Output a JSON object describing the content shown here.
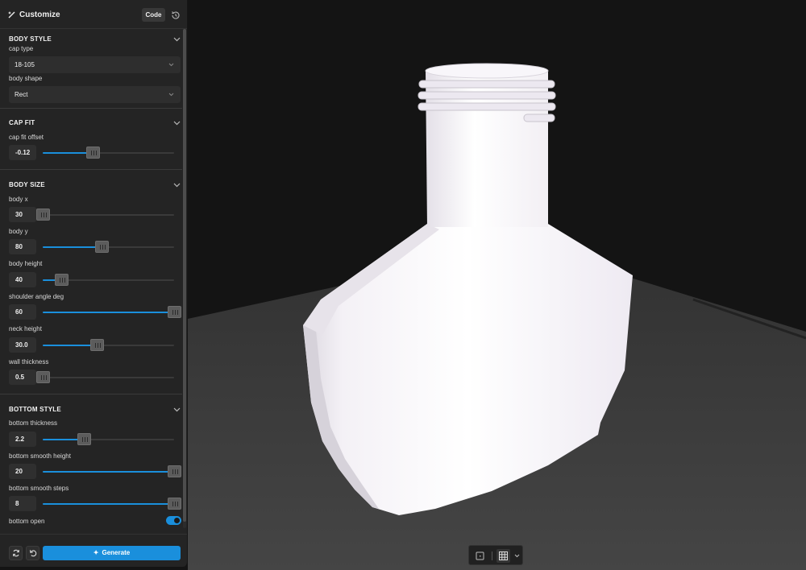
{
  "panel": {
    "title": "Customize",
    "code_label": "Code"
  },
  "sections": {
    "body_style": {
      "title": "BODY STYLE",
      "cap_type": {
        "label": "cap type",
        "value": "18-105"
      },
      "body_shape": {
        "label": "body shape",
        "value": "Rect"
      }
    },
    "cap_fit": {
      "title": "CAP FIT",
      "cap_fit_offset": {
        "label": "cap fit offset",
        "value": "-0.12",
        "fraction": 0.38
      }
    },
    "body_size": {
      "title": "BODY SIZE",
      "body_x": {
        "label": "body x",
        "value": "30",
        "fraction": 0.0
      },
      "body_y": {
        "label": "body y",
        "value": "80",
        "fraction": 0.45
      },
      "body_height": {
        "label": "body height",
        "value": "40",
        "fraction": 0.14
      },
      "shoulder_angle_deg": {
        "label": "shoulder angle deg",
        "value": "60",
        "fraction": 1.0
      },
      "neck_height": {
        "label": "neck height",
        "value": "30.0",
        "fraction": 0.41
      },
      "wall_thickness": {
        "label": "wall thickness",
        "value": "0.5",
        "fraction": 0.0
      }
    },
    "bottom_style": {
      "title": "BOTTOM STYLE",
      "bottom_thickness": {
        "label": "bottom thickness",
        "value": "2.2",
        "fraction": 0.31
      },
      "bottom_smooth_height": {
        "label": "bottom smooth height",
        "value": "20",
        "fraction": 1.0
      },
      "bottom_smooth_steps": {
        "label": "bottom smooth steps",
        "value": "8",
        "fraction": 1.0
      },
      "bottom_open": {
        "label": "bottom open",
        "on": true
      }
    }
  },
  "footer": {
    "generate_label": "Generate"
  },
  "colors": {
    "accent": "#1a8fdc",
    "panel_bg": "#242424",
    "viewport_bg": "#141414",
    "model": "#f6f3f8"
  },
  "icons": {
    "title": "wand-icon",
    "history": "history-icon",
    "refresh": "refresh-icon",
    "reset": "undo-icon",
    "generate": "sparkle-icon",
    "view_single": "single-view-icon",
    "view_grid": "grid-view-icon"
  }
}
